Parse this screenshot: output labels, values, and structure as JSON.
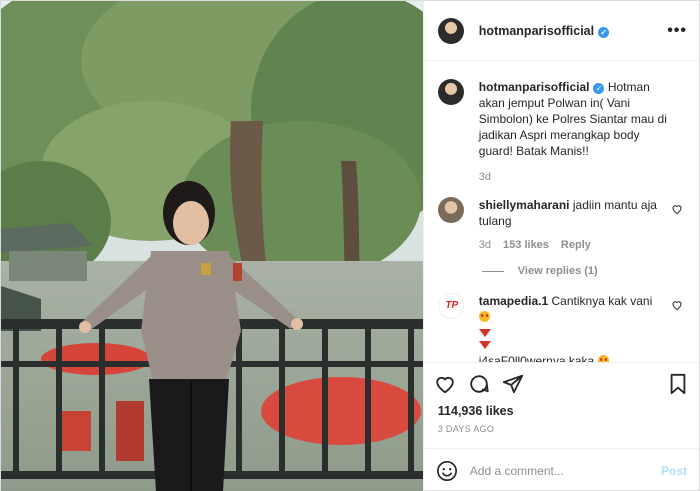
{
  "post": {
    "username": "hotmanparisofficial",
    "verified_mark": "✓",
    "caption": "Hotman akan jemput Polwan in( Vani Simbolon) ke Polres Siantar mau di jadikan Aspri merangkap body guard! Batak Manis!!",
    "caption_age": "3d"
  },
  "comments": [
    {
      "username": "shiellymaharani",
      "text": "jadiin mantu aja tulang",
      "age": "3d",
      "likes": "153 likes",
      "reply_label": "Reply",
      "view_replies": "View replies (1)"
    },
    {
      "username": "tamapedia.1",
      "text_line1": "Cantiknya kak vani",
      "text_line2": "j4saF0ll0wernya kaka",
      "logo_text": "TP"
    }
  ],
  "footer": {
    "likes": "114,936 likes",
    "time": "3 DAYS AGO",
    "comment_placeholder": "Add a comment...",
    "post_label": "Post"
  },
  "icons": {
    "more": "more-icon",
    "heart": "heart-icon",
    "comment": "comment-icon",
    "share": "share-icon",
    "save": "save-icon",
    "emoji": "emoji-icon"
  }
}
